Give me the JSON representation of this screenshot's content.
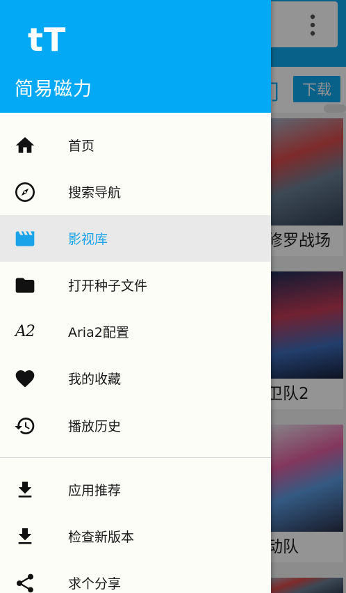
{
  "drawer": {
    "logo_text": "tT",
    "app_name": "简易磁力",
    "items": [
      {
        "label": "首页",
        "icon": "home-icon"
      },
      {
        "label": "搜索导航",
        "icon": "compass-icon"
      },
      {
        "label": "影视库",
        "icon": "clapperboard-icon",
        "active": true
      },
      {
        "label": "打开种子文件",
        "icon": "folder-icon"
      },
      {
        "label": "Aria2配置",
        "icon": "aria2-icon",
        "glyph": "A2"
      },
      {
        "label": "我的收藏",
        "icon": "heart-icon"
      },
      {
        "label": "播放历史",
        "icon": "history-icon"
      }
    ],
    "secondary_items": [
      {
        "label": "应用推荐",
        "icon": "download-icon"
      },
      {
        "label": "检查新版本",
        "icon": "download-icon"
      },
      {
        "label": "求个分享",
        "icon": "share-icon"
      }
    ]
  },
  "background": {
    "filter_text": "门",
    "download_label": "下载",
    "cards": [
      {
        "title": "修罗战场"
      },
      {
        "title": "卫队2"
      },
      {
        "title": "动队"
      }
    ]
  },
  "colors": {
    "accent": "#03a9f4",
    "active_label": "#1aa3e8",
    "active_bg": "#e9e9e9",
    "drawer_bg": "#fdfdf8"
  }
}
